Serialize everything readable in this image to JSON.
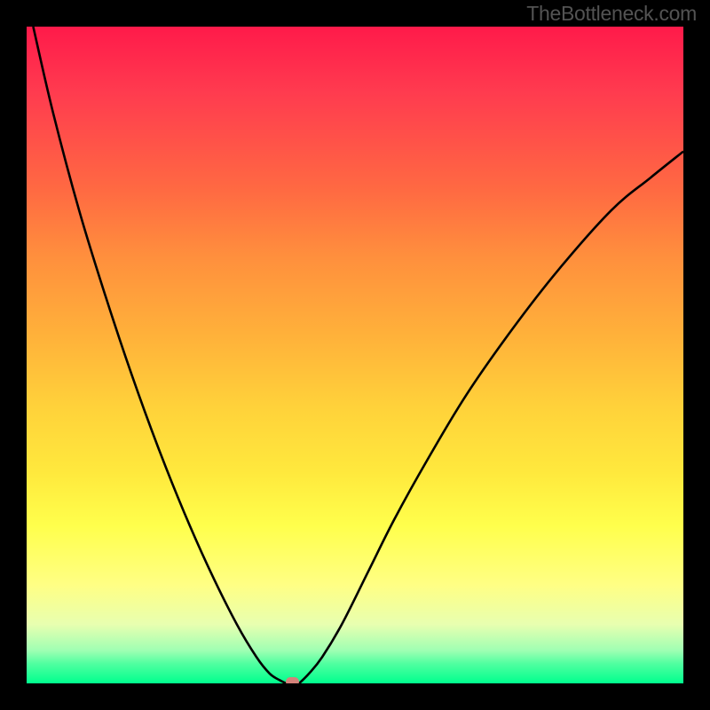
{
  "watermark": "TheBottleneck.com",
  "chart_data": {
    "type": "line",
    "title": "",
    "xlabel": "",
    "ylabel": "",
    "xlim": [
      0,
      100
    ],
    "ylim": [
      0,
      100
    ],
    "background": "gradient",
    "gradient_stops": [
      {
        "pos": 0.0,
        "color": "#ff1a4a"
      },
      {
        "pos": 0.1,
        "color": "#ff3b4f"
      },
      {
        "pos": 0.25,
        "color": "#ff6a42"
      },
      {
        "pos": 0.35,
        "color": "#ff8f3d"
      },
      {
        "pos": 0.48,
        "color": "#ffb43a"
      },
      {
        "pos": 0.58,
        "color": "#ffd23a"
      },
      {
        "pos": 0.68,
        "color": "#ffe93d"
      },
      {
        "pos": 0.76,
        "color": "#ffff4c"
      },
      {
        "pos": 0.85,
        "color": "#ffff84"
      },
      {
        "pos": 0.91,
        "color": "#e8ffb0"
      },
      {
        "pos": 0.95,
        "color": "#9fffb3"
      },
      {
        "pos": 0.97,
        "color": "#50ffa0"
      },
      {
        "pos": 1.0,
        "color": "#00ff8e"
      }
    ],
    "series": [
      {
        "name": "left-branch",
        "x": [
          1.0,
          4.0,
          8.0,
          12.0,
          16.0,
          20.0,
          24.0,
          28.0,
          32.0,
          35.0,
          37.0,
          38.5,
          39.5
        ],
        "values": [
          100.0,
          87.0,
          72.0,
          59.0,
          47.0,
          36.0,
          26.0,
          17.0,
          9.0,
          4.0,
          1.5,
          0.5,
          0.0
        ]
      },
      {
        "name": "right-branch",
        "x": [
          41.5,
          43.0,
          45.0,
          48.0,
          52.0,
          56.0,
          61.0,
          67.0,
          74.0,
          81.0,
          89.0,
          95.0,
          100.0
        ],
        "values": [
          0.0,
          1.5,
          4.0,
          9.0,
          17.0,
          25.0,
          34.0,
          44.0,
          54.0,
          63.0,
          72.0,
          77.0,
          81.0
        ]
      }
    ],
    "marker": {
      "x": 40.5,
      "y": 0.0,
      "color": "#d4827a"
    },
    "flat_segment": {
      "x_start": 39.5,
      "x_end": 41.5,
      "y": 0.0
    },
    "min_point": {
      "x": 40.5,
      "y": 0.0
    }
  }
}
